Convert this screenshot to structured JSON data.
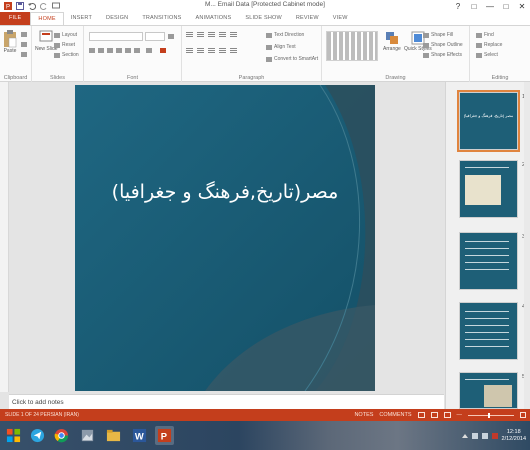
{
  "window": {
    "title": "M... Email Data [Protected Cabinet mode]",
    "controls": [
      "?",
      "□",
      "—",
      "□",
      "✕"
    ]
  },
  "tabs": [
    {
      "label": "FILE"
    },
    {
      "label": "HOME"
    },
    {
      "label": "INSERT"
    },
    {
      "label": "DESIGN"
    },
    {
      "label": "TRANSITIONS"
    },
    {
      "label": "ANIMATIONS"
    },
    {
      "label": "SLIDE SHOW"
    },
    {
      "label": "REVIEW"
    },
    {
      "label": "VIEW"
    }
  ],
  "ribbon": {
    "clipboard": {
      "paste_label": "Paste",
      "group_label": "Clipboard"
    },
    "slides": {
      "new_slide_label": "New Slide",
      "layout_label": "Layout",
      "reset_label": "Reset",
      "section_label": "Section",
      "group_label": "Slides"
    },
    "font": {
      "group_label": "Font"
    },
    "paragraph": {
      "text_direction_label": "Text Direction",
      "align_text_label": "Align Text",
      "convert_label": "Convert to SmartArt",
      "group_label": "Paragraph"
    },
    "drawing": {
      "arrange_label": "Arrange",
      "quick_styles_label": "Quick Styles",
      "shape_fill_label": "Shape Fill",
      "shape_outline_label": "Shape Outline",
      "shape_effects_label": "Shape Effects",
      "group_label": "Drawing"
    },
    "editing": {
      "find_label": "Find",
      "replace_label": "Replace",
      "select_label": "Select",
      "group_label": "Editing"
    }
  },
  "slide": {
    "title": "مصر(تاریخ,فرهنگ و جغرافیا)"
  },
  "thumbnails": [
    {
      "number": "1",
      "title": "مصر (تاریخ، فرهنگ و جغرافیا)"
    },
    {
      "number": "2",
      "title": ""
    },
    {
      "number": "3",
      "title": ""
    },
    {
      "number": "4",
      "title": ""
    },
    {
      "number": "5",
      "title": ""
    }
  ],
  "notes": {
    "placeholder": "Click to add notes"
  },
  "statusbar": {
    "left": "SLIDE 1 OF 24    PERSIAN (IRAN)",
    "notes_label": "NOTES",
    "comments_label": "COMMENTS",
    "zoom": "—"
  },
  "taskbar": {
    "clock_time": "12:18",
    "clock_date": "2/12/2014"
  },
  "colors": {
    "accent": "#c43e1c",
    "slide_bg": "#1b5c74",
    "thumb_selected": "#e0843f"
  }
}
